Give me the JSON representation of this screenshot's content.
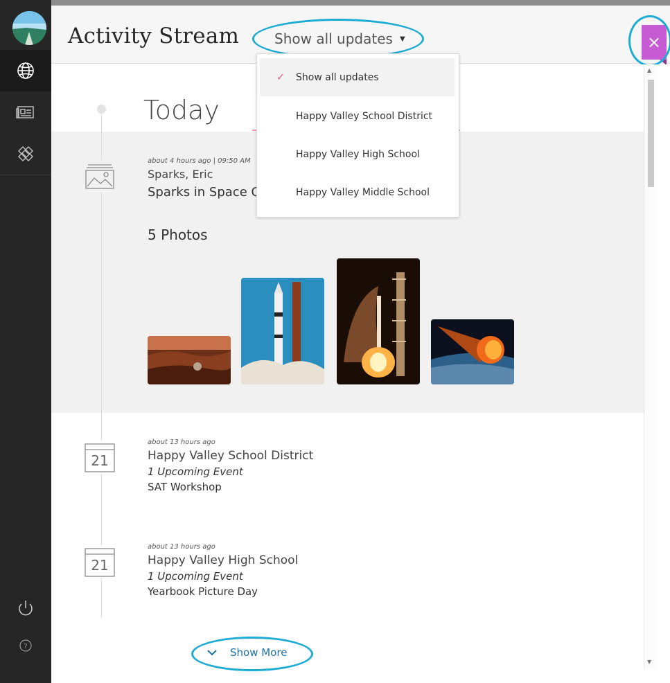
{
  "header": {
    "title": "Activity Stream",
    "filter_label": "Show all updates",
    "close_label": "×"
  },
  "dropdown": {
    "options": [
      {
        "label": "Show all updates",
        "selected": true
      },
      {
        "label": "Happy Valley School District",
        "selected": false
      },
      {
        "label": "Happy Valley High School",
        "selected": false
      },
      {
        "label": "Happy Valley Middle School",
        "selected": false
      }
    ]
  },
  "stream": {
    "section_heading": "Today",
    "entries": [
      {
        "type": "photos",
        "meta": "about 4 hours ago  |  09:50 AM",
        "author": "Sparks, Eric",
        "subject": "Sparks in Space G",
        "count_label": "5 Photos",
        "icon": "image-icon"
      },
      {
        "type": "event",
        "meta": "about 13 hours ago",
        "org": "Happy Valley School District",
        "summary": "1 Upcoming Event",
        "detail": "SAT Workshop",
        "calendar_day": "21",
        "icon": "calendar-icon"
      },
      {
        "type": "event",
        "meta": "about 13 hours ago",
        "org": "Happy Valley High School",
        "summary": "1 Upcoming Event",
        "detail": "Yearbook Picture Day",
        "calendar_day": "21",
        "icon": "calendar-icon"
      }
    ],
    "show_more_label": "Show More"
  },
  "sidebar": {
    "items": [
      "globe-icon",
      "news-icon",
      "tools-icon",
      "power-icon",
      "help-icon"
    ]
  },
  "colors": {
    "accent_highlight": "#1eabd3",
    "close_button": "#c75bd3",
    "link": "#1f6fa8",
    "check": "#d4567b",
    "sidebar": "#262626"
  }
}
